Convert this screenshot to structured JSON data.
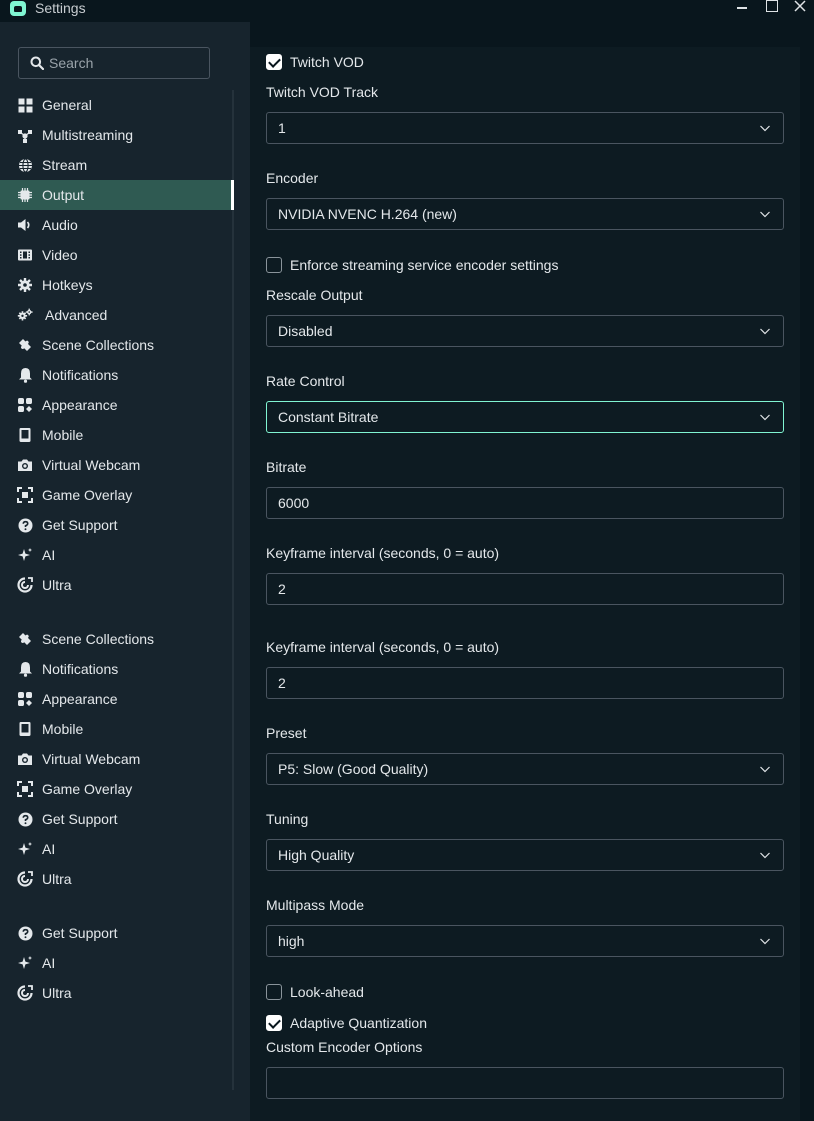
{
  "window": {
    "title": "Settings"
  },
  "search": {
    "placeholder": "Search"
  },
  "sidebar": {
    "items": [
      {
        "label": "General",
        "icon": "grid-icon"
      },
      {
        "label": "Multistreaming",
        "icon": "multistream-icon"
      },
      {
        "label": "Stream",
        "icon": "globe-icon"
      },
      {
        "label": "Output",
        "icon": "chip-icon",
        "active": true
      },
      {
        "label": "Audio",
        "icon": "speaker-icon"
      },
      {
        "label": "Video",
        "icon": "film-icon"
      },
      {
        "label": "Hotkeys",
        "icon": "gear-icon"
      },
      {
        "label": "Advanced",
        "icon": "gears-icon"
      },
      {
        "label": "Scene Collections",
        "icon": "puzzle-icon"
      },
      {
        "label": "Notifications",
        "icon": "bell-icon"
      },
      {
        "label": "Appearance",
        "icon": "palette-icon"
      },
      {
        "label": "Mobile",
        "icon": "mobile-icon"
      },
      {
        "label": "Virtual Webcam",
        "icon": "camera-icon"
      },
      {
        "label": "Game Overlay",
        "icon": "overlay-icon"
      },
      {
        "label": "Get Support",
        "icon": "help-icon"
      },
      {
        "label": "AI",
        "icon": "sparkle-icon"
      },
      {
        "label": "Ultra",
        "icon": "ultra-icon"
      },
      {
        "label": "Scene Collections",
        "icon": "puzzle-icon"
      },
      {
        "label": "Notifications",
        "icon": "bell-icon"
      },
      {
        "label": "Appearance",
        "icon": "palette-icon"
      },
      {
        "label": "Mobile",
        "icon": "mobile-icon"
      },
      {
        "label": "Virtual Webcam",
        "icon": "camera-icon"
      },
      {
        "label": "Game Overlay",
        "icon": "overlay-icon"
      },
      {
        "label": "Get Support",
        "icon": "help-icon"
      },
      {
        "label": "AI",
        "icon": "sparkle-icon"
      },
      {
        "label": "Ultra",
        "icon": "ultra-icon"
      },
      {
        "label": "Get Support",
        "icon": "help-icon"
      },
      {
        "label": "AI",
        "icon": "sparkle-icon"
      },
      {
        "label": "Ultra",
        "icon": "ultra-icon"
      }
    ]
  },
  "output": {
    "twitch_vod": {
      "label": "Twitch VOD",
      "checked": true
    },
    "twitch_vod_track": {
      "label": "Twitch VOD Track",
      "value": "1"
    },
    "encoder": {
      "label": "Encoder",
      "value": "NVIDIA NVENC H.264 (new)"
    },
    "enforce": {
      "label": "Enforce streaming service encoder settings",
      "checked": false
    },
    "rescale": {
      "label": "Rescale Output",
      "value": "Disabled"
    },
    "rate_control": {
      "label": "Rate Control",
      "value": "Constant Bitrate"
    },
    "bitrate": {
      "label": "Bitrate",
      "value": "6000"
    },
    "keyframe1": {
      "label": "Keyframe interval (seconds, 0 = auto)",
      "value": "2"
    },
    "keyframe2": {
      "label": "Keyframe interval (seconds, 0 = auto)",
      "value": "2"
    },
    "preset": {
      "label": "Preset",
      "value": "P5: Slow (Good Quality)"
    },
    "tuning": {
      "label": "Tuning",
      "value": "High Quality"
    },
    "multipass": {
      "label": "Multipass Mode",
      "value": "high"
    },
    "lookahead": {
      "label": "Look-ahead",
      "checked": false
    },
    "adaptive_q": {
      "label": "Adaptive Quantization",
      "checked": true
    },
    "custom": {
      "label": "Custom Encoder Options",
      "value": ""
    }
  },
  "colors": {
    "background": "#09161d",
    "sidebar": "#17242d",
    "panel": "#0d1b22",
    "active": "#2f5a52",
    "accent": "#80f5d2"
  }
}
